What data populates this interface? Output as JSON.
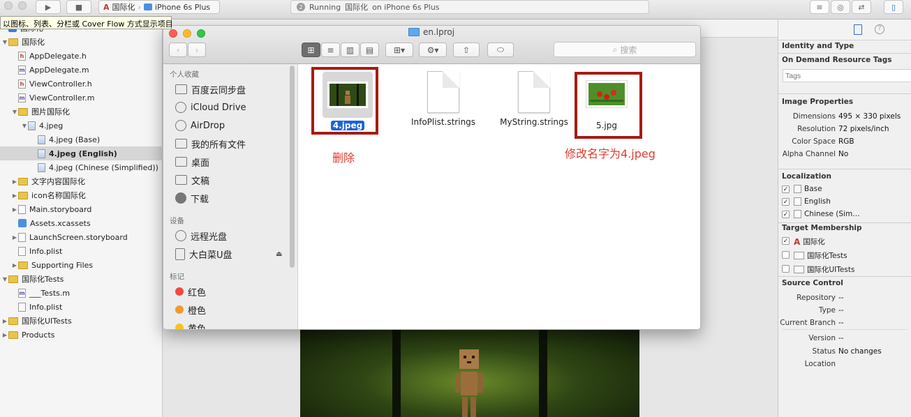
{
  "toolbar": {
    "scheme_target": "国际化",
    "scheme_device": "iPhone 6s Plus",
    "activity_prefix": "Running",
    "activity_app": "国际化",
    "activity_suffix": "on iPhone 6s Plus",
    "run_count": "2"
  },
  "tooltip": "以图标、列表、分栏或 Cover Flow 方式显示项目",
  "navigator": {
    "items": [
      {
        "label": "国际化",
        "level": 0,
        "icon": "project-icon",
        "disclosure": ""
      },
      {
        "label": "国际化",
        "level": 0,
        "icon": "folder-icon",
        "disclosure": "open"
      },
      {
        "label": "AppDelegate.h",
        "level": 1,
        "icon": "header-file-icon",
        "disclosure": ""
      },
      {
        "label": "AppDelegate.m",
        "level": 1,
        "icon": "source-file-icon",
        "disclosure": ""
      },
      {
        "label": "ViewController.h",
        "level": 1,
        "icon": "header-file-icon",
        "disclosure": ""
      },
      {
        "label": "ViewController.m",
        "level": 1,
        "icon": "source-file-icon",
        "disclosure": ""
      },
      {
        "label": "图片国际化",
        "level": 1,
        "icon": "folder-icon",
        "disclosure": "open"
      },
      {
        "label": "4.jpeg",
        "level": 2,
        "icon": "image-file-icon",
        "disclosure": "open"
      },
      {
        "label": "4.jpeg (Base)",
        "level": 3,
        "icon": "image-file-icon",
        "disclosure": ""
      },
      {
        "label": "4.jpeg (English)",
        "level": 3,
        "icon": "image-file-icon",
        "disclosure": "",
        "selected": true
      },
      {
        "label": "4.jpeg (Chinese (Simplified))",
        "level": 3,
        "icon": "image-file-icon",
        "disclosure": ""
      },
      {
        "label": "文字内容国际化",
        "level": 1,
        "icon": "folder-icon",
        "disclosure": "closed"
      },
      {
        "label": "icon名称国际化",
        "level": 1,
        "icon": "folder-icon",
        "disclosure": "closed"
      },
      {
        "label": "Main.storyboard",
        "level": 1,
        "icon": "storyboard-icon",
        "disclosure": "closed"
      },
      {
        "label": "Assets.xcassets",
        "level": 1,
        "icon": "asset-catalog-icon",
        "disclosure": ""
      },
      {
        "label": "LaunchScreen.storyboard",
        "level": 1,
        "icon": "storyboard-icon",
        "disclosure": "closed"
      },
      {
        "label": "Info.plist",
        "level": 1,
        "icon": "plist-file-icon",
        "disclosure": ""
      },
      {
        "label": "Supporting Files",
        "level": 1,
        "icon": "folder-icon",
        "disclosure": "closed"
      },
      {
        "label": "国际化Tests",
        "level": 0,
        "icon": "folder-icon",
        "disclosure": "open"
      },
      {
        "label": "___Tests.m",
        "level": 1,
        "icon": "source-file-icon",
        "disclosure": ""
      },
      {
        "label": "Info.plist",
        "level": 1,
        "icon": "plist-file-icon",
        "disclosure": ""
      },
      {
        "label": "国际化UITests",
        "level": 0,
        "icon": "folder-icon",
        "disclosure": "closed"
      },
      {
        "label": "Products",
        "level": 0,
        "icon": "folder-icon",
        "disclosure": "closed"
      }
    ]
  },
  "finder": {
    "title": "en.lproj",
    "search_placeholder": "搜索",
    "sidebar": {
      "favorites_header": "个人收藏",
      "favorites": [
        {
          "label": "百度云同步盘",
          "icon": "folder-icon"
        },
        {
          "label": "iCloud Drive",
          "icon": "cloud-icon"
        },
        {
          "label": "AirDrop",
          "icon": "airdrop-icon"
        },
        {
          "label": "我的所有文件",
          "icon": "all-files-icon"
        },
        {
          "label": "桌面",
          "icon": "desktop-icon"
        },
        {
          "label": "文稿",
          "icon": "documents-icon"
        },
        {
          "label": "下载",
          "icon": "downloads-icon"
        }
      ],
      "devices_header": "设备",
      "devices": [
        {
          "label": "远程光盘",
          "icon": "optical-disc-icon"
        },
        {
          "label": "大白菜U盘",
          "icon": "usb-drive-icon",
          "eject": "⏏"
        }
      ],
      "tags_header": "标记",
      "tags": [
        {
          "label": "红色",
          "color": "#f04a3e"
        },
        {
          "label": "橙色",
          "color": "#f39a2b"
        },
        {
          "label": "黄色",
          "color": "#f5c518"
        }
      ]
    },
    "files": [
      {
        "name": "4.jpeg",
        "kind": "image-green",
        "selected": true
      },
      {
        "name": "InfoPlist.strings",
        "kind": "document"
      },
      {
        "name": "MyString.strings",
        "kind": "document"
      },
      {
        "name": "5.jpg",
        "kind": "image-red"
      }
    ]
  },
  "annotations": {
    "delete_note": "删除",
    "rename_note": "修改名字为4.jpeg",
    "annotation_color": "#e03b2f",
    "box_color": "#a61c12"
  },
  "inspector": {
    "identity_title": "Identity and Type",
    "odr_title": "On Demand Resource Tags",
    "tags_placeholder": "Tags",
    "image_title": "Image Properties",
    "dimensions_label": "Dimensions",
    "dimensions_value": "495 × 330 pixels",
    "resolution_label": "Resolution",
    "resolution_value": "72 pixels/inch",
    "colorspace_label": "Color Space",
    "colorspace_value": "RGB",
    "alpha_label": "Alpha Channel",
    "alpha_value": "No",
    "localization_title": "Localization",
    "localizations": [
      {
        "label": "Base",
        "checked": true
      },
      {
        "label": "English",
        "checked": true
      },
      {
        "label": "Chinese (Sim…",
        "checked": true
      }
    ],
    "target_title": "Target Membership",
    "targets": [
      {
        "label": "国际化",
        "checked": true
      },
      {
        "label": "国际化Tests",
        "checked": false
      },
      {
        "label": "国际化UITests",
        "checked": false
      }
    ],
    "source_title": "Source Control",
    "repository_label": "Repository",
    "repository_value": "--",
    "type_label": "Type",
    "type_value": "--",
    "branch_label": "Current Branch",
    "branch_value": "--",
    "version_label": "Version",
    "version_value": "--",
    "status_label": "Status",
    "status_value": "No changes",
    "location_label": "Location"
  }
}
